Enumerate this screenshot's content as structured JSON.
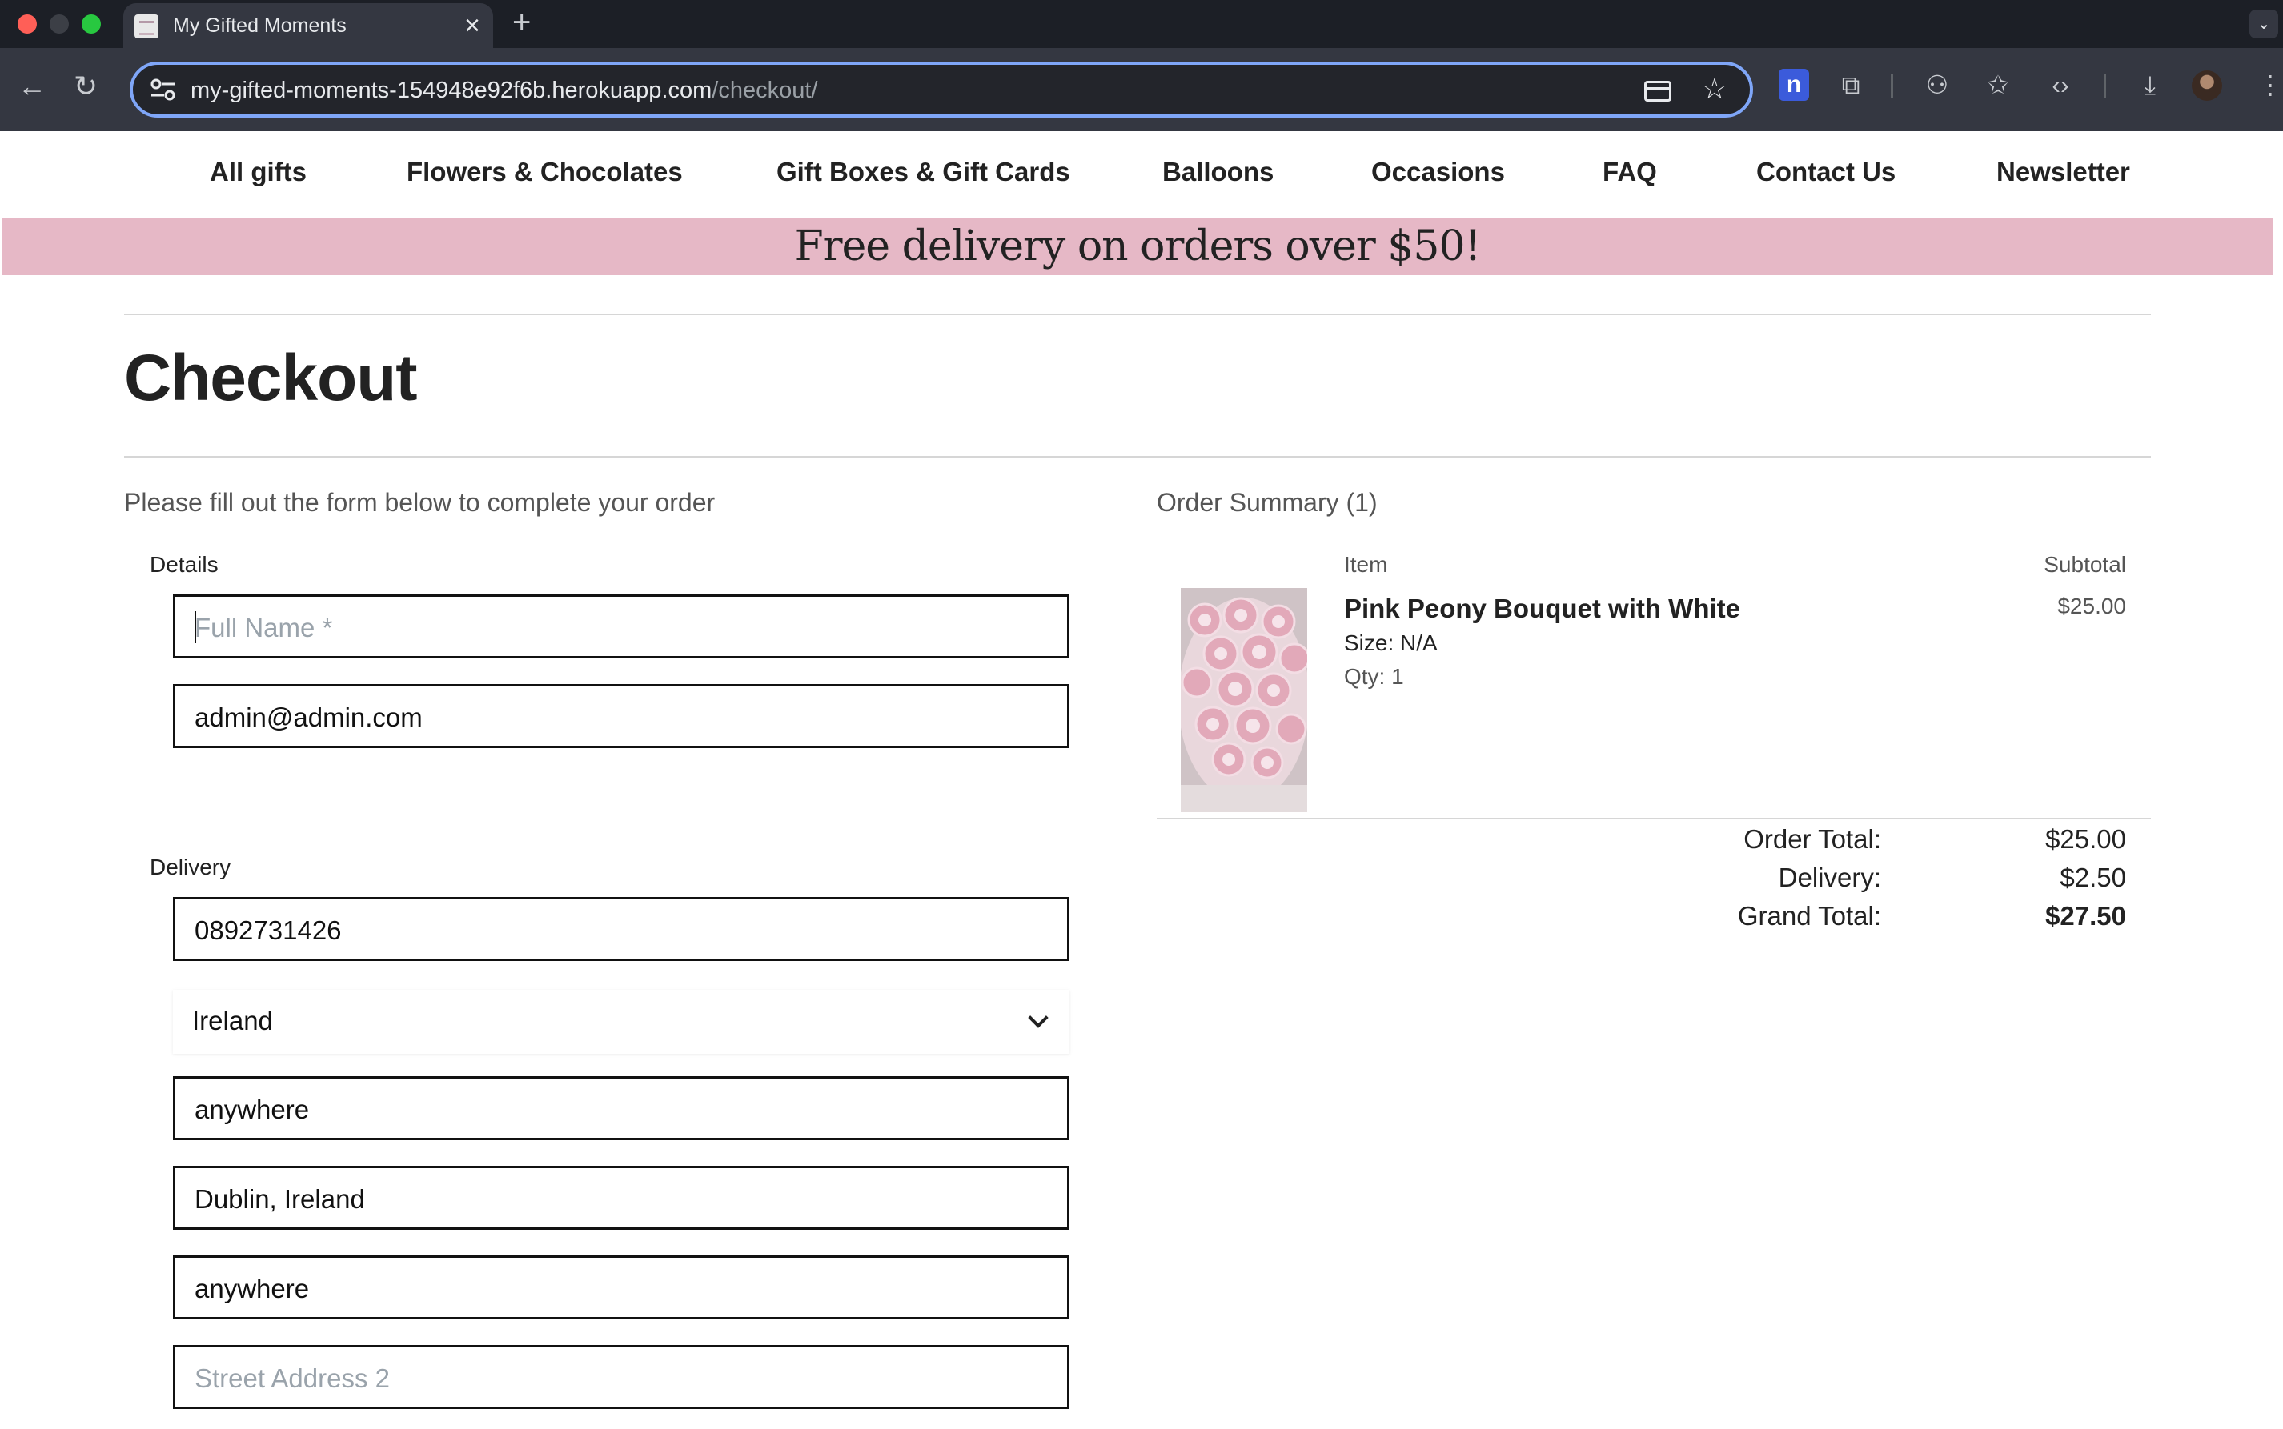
{
  "browser": {
    "tab_title": "My Gifted Moments",
    "url_host": "my-gifted-moments-154948e92f6b.herokuapp.com",
    "url_path": "/checkout/",
    "extension_badge": "n"
  },
  "nav": {
    "items": [
      {
        "label": "All gifts"
      },
      {
        "label": "Flowers & Chocolates"
      },
      {
        "label": "Gift Boxes & Gift Cards"
      },
      {
        "label": "Balloons"
      },
      {
        "label": "Occasions"
      },
      {
        "label": "FAQ"
      },
      {
        "label": "Contact Us"
      },
      {
        "label": "Newsletter"
      }
    ]
  },
  "banner": {
    "text": "Free delivery on orders over $50!",
    "color": "#e6b8c6"
  },
  "page": {
    "title": "Checkout"
  },
  "form": {
    "intro": "Please fill out the form below to complete your order",
    "details": {
      "legend": "Details",
      "full_name": {
        "value": "",
        "placeholder": "Full Name *"
      },
      "email": {
        "value": "admin@admin.com"
      }
    },
    "delivery": {
      "legend": "Delivery",
      "phone": {
        "value": "0892731426"
      },
      "country": {
        "selected": "Ireland"
      },
      "field_3": {
        "value": "anywhere"
      },
      "field_4": {
        "value": "Dublin, Ireland"
      },
      "field_5": {
        "value": "anywhere"
      },
      "street_address_2": {
        "value": "",
        "placeholder": "Street Address 2"
      }
    }
  },
  "summary": {
    "title": "Order Summary (1)",
    "col_item": "Item",
    "col_subtotal": "Subtotal",
    "item": {
      "name": "Pink Peony Bouquet with White",
      "size": "Size: N/A",
      "qty": "Qty: 1",
      "subtotal": "$25.00"
    },
    "totals": {
      "order_total_label": "Order Total:",
      "order_total": "$25.00",
      "delivery_label": "Delivery:",
      "delivery": "$2.50",
      "grand_total_label": "Grand Total:",
      "grand_total": "$27.50"
    }
  }
}
